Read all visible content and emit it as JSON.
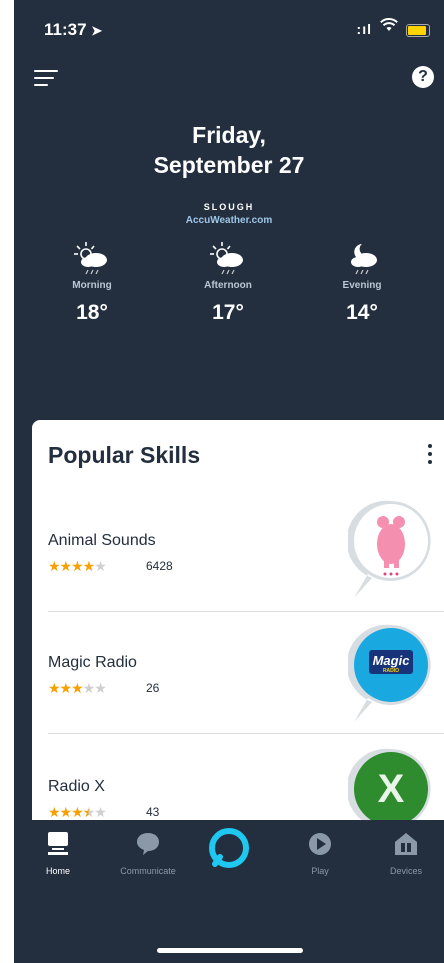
{
  "status_bar": {
    "time": "11:37",
    "location_icon": "location-arrow-icon",
    "signal_text": ":ıl",
    "wifi_icon": "wifi-icon",
    "battery_level": 0.8,
    "battery_color": "#ffd400"
  },
  "header": {
    "menu_icon": "hamburger-menu-icon",
    "help_label": "?"
  },
  "date": {
    "line1": "Friday,",
    "line2": "September 27"
  },
  "weather": {
    "city": "SLOUGH",
    "source": "AccuWeather.com",
    "periods": [
      {
        "label": "Morning",
        "temp": "18°",
        "icon": "sun-cloud-rain-icon"
      },
      {
        "label": "Afternoon",
        "temp": "17°",
        "icon": "sun-cloud-rain-icon"
      },
      {
        "label": "Evening",
        "temp": "14°",
        "icon": "moon-cloud-rain-icon"
      }
    ]
  },
  "popular_skills": {
    "title": "Popular Skills",
    "items": [
      {
        "name": "Animal Sounds",
        "rating": 4,
        "count": "6428",
        "badge": "animal-sounds-badge"
      },
      {
        "name": "Magic Radio",
        "rating": 3,
        "count": "26",
        "badge": "magic-radio-badge",
        "badge_text": "Magic",
        "badge_subtext": "RADIO"
      },
      {
        "name": "Radio X",
        "rating": 3.5,
        "count": "43",
        "badge": "radio-x-badge",
        "badge_text": "X"
      }
    ]
  },
  "bottom_nav": {
    "tabs": [
      {
        "label": "Home",
        "active": true
      },
      {
        "label": "Communicate",
        "active": false
      },
      {
        "label": "",
        "active": false
      },
      {
        "label": "Play",
        "active": false
      },
      {
        "label": "Devices",
        "active": false
      }
    ]
  },
  "colors": {
    "header_bg": "#232f3e",
    "star": "#f7a000",
    "alexa_ring": "#1ec8f0"
  }
}
